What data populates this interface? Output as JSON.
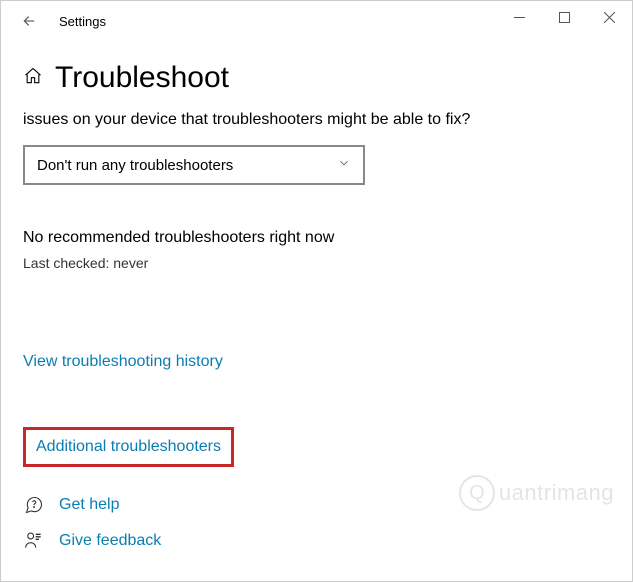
{
  "window": {
    "title": "Settings"
  },
  "page": {
    "title": "Troubleshoot",
    "description": "issues on your device that troubleshooters might be able to fix?"
  },
  "dropdown": {
    "selected": "Don't run any troubleshooters"
  },
  "status": {
    "text": "No recommended troubleshooters right now",
    "last_checked": "Last checked: never"
  },
  "links": {
    "history": "View troubleshooting history",
    "additional": "Additional troubleshooters",
    "get_help": "Get help",
    "give_feedback": "Give feedback"
  },
  "watermark": {
    "text": "uantrimang"
  }
}
